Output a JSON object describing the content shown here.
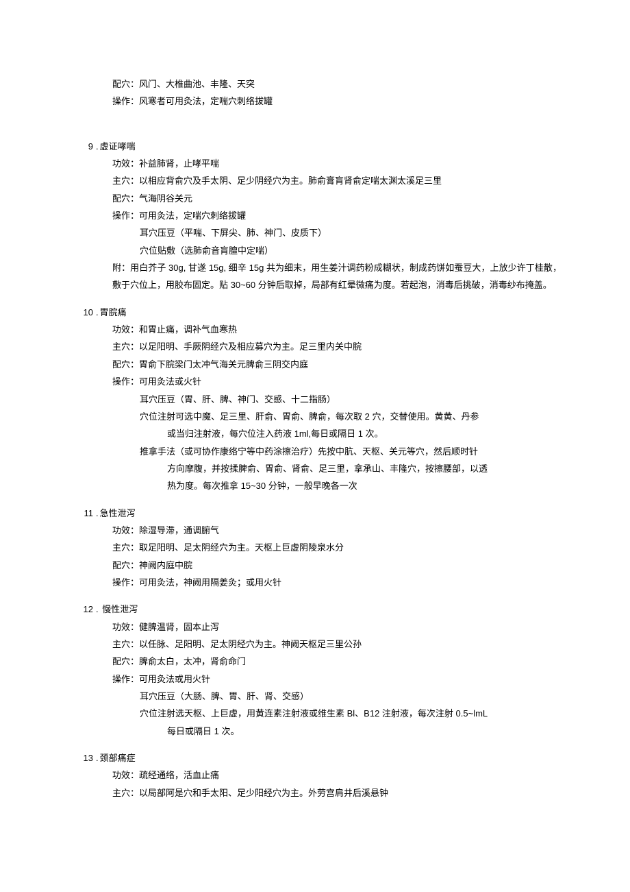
{
  "intro": {
    "peixue": "配穴：风门、大椎曲池、丰隆、天突",
    "caozuo": "操作：风寒者可用灸法，定喘穴刺络拔罐"
  },
  "sections": [
    {
      "num": "9",
      "title": "虚证哮喘",
      "fields": [
        {
          "label": "功效：",
          "value": "补益肺肾，止哮平喘"
        },
        {
          "label": "主穴：",
          "value": "以相应背俞穴及手太阴、足少阴经穴为主。肺俞膏肓肾俞定喘太渊太溪足三里"
        },
        {
          "label": "配穴：",
          "value": "气海阴谷关元"
        },
        {
          "label": "操作：",
          "value": "可用灸法，定喘穴刺络拔罐"
        }
      ],
      "subs": [
        "耳穴压豆（平喘、下屏尖、肺、神门、皮质下）",
        "穴位贴敷（选肺俞音肓膻中定喘）"
      ],
      "note": "附：用白芥子 30g, 甘遂 15g, 细辛 15g 共为细末，用生姜汁调药粉成糊状，制成药饼如蚕豆大，上放少许丁桂散，敷于穴位上，用胶布固定。贴 30~60 分钟后取掉，局部有红晕微痛为度。若起泡，消毒后挑破，消毒纱布掩盖。"
    },
    {
      "num": "10",
      "title": "胃脘痛",
      "fields": [
        {
          "label": "功效：",
          "value": "和胃止痛，调补气血寒热"
        },
        {
          "label": "主穴：",
          "value": "以足阳明、手厥阴经穴及相应募穴为主。足三里内关中脘"
        },
        {
          "label": "配穴：",
          "value": "胃俞下脘梁门太冲气海关元脾俞三阴交内庭"
        },
        {
          "label": "操作：",
          "value": "可用灸法或火针"
        }
      ],
      "subs": [
        "耳穴压豆（胃、肝、脾、神门、交感、十二指肠）"
      ],
      "subs_wrapped": [
        {
          "first": "穴位注射可选中魔、足三里、肝俞、胃俞、脾俞，每次取 2 穴，交替使用。黄黄、丹参",
          "cont": [
            "或当归注射液，每穴位注入药液 1ml,每日或隔日 1 次。"
          ]
        },
        {
          "first": "推拿手法（或可协作康络宁等中药涂擦治疗）先按中肮、天枢、关元等穴，然后顺时针",
          "cont": [
            "方向摩腹，并按揉脾俞、胃俞、肾俞、足三里，拿承山、丰隆穴，按擦腰部，以透",
            "热为度。每次推拿 15~30 分钟，一般早晚各一次"
          ]
        }
      ]
    },
    {
      "num": "11",
      "title": "急性泄泻",
      "fields": [
        {
          "label": "功效：",
          "value": "除湿导滞，通调腑气"
        },
        {
          "label": "主穴：",
          "value": "取足阳明、足太阴经穴为主。天枢上巨虚阴陵泉水分"
        },
        {
          "label": "配穴：",
          "value": "神阙内庭中脘"
        },
        {
          "label": "操作：",
          "value": "可用灸法，神阙用隔姜灸；或用火针"
        }
      ]
    },
    {
      "num": "12",
      "title": "慢性泄泻",
      "fields": [
        {
          "label": "功效：",
          "value": "健脾温肾，固本止泻"
        },
        {
          "label": "主穴：",
          "value": "以任脉、足阳明、足太阴经穴为主。神阙天枢足三里公孙"
        },
        {
          "label": "配穴：",
          "value": "脾俞太白，太冲，肾俞命门"
        },
        {
          "label": "操作：",
          "value": "可用灸法或用火针"
        }
      ],
      "subs": [
        "耳穴压豆（大肠、脾、胃、肝、肾、交感）"
      ],
      "subs_wrapped": [
        {
          "first": "穴位注射选天枢、上巨虚，用黄连素注射液或维生素 Bl、B12 注射液，每次注射 0.5~lmL",
          "cont": [
            "每日或隔日 1 次。"
          ]
        }
      ]
    },
    {
      "num": "13",
      "title": "颈部痛症",
      "fields": [
        {
          "label": "功效：",
          "value": "疏经通络，活血止痛"
        },
        {
          "label": "主穴：",
          "value": "以局部阿是穴和手太阳、足少阳经穴为主。外劳宫肩井后溪悬钟"
        }
      ]
    }
  ]
}
